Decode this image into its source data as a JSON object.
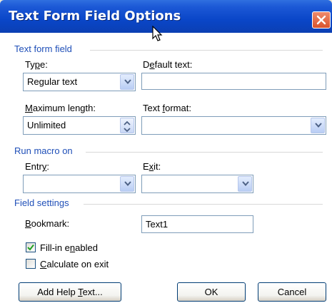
{
  "dialog": {
    "title": "Text Form Field Options"
  },
  "sections": {
    "text_form_field": "Text form field",
    "run_macro_on": "Run macro on",
    "field_settings": "Field settings"
  },
  "type_field": {
    "label_pre": "Ty",
    "label_key": "p",
    "label_post": "e:",
    "value": "Regular text"
  },
  "default_text": {
    "label_pre": "D",
    "label_key": "e",
    "label_post": "fault text:",
    "value": ""
  },
  "max_length": {
    "label_pre": "",
    "label_key": "M",
    "label_post": "aximum length:",
    "value": "Unlimited"
  },
  "text_format": {
    "label_pre": "Text ",
    "label_key": "f",
    "label_post": "ormat:",
    "value": ""
  },
  "entry": {
    "label_pre": "Entr",
    "label_key": "y",
    "label_post": ":",
    "value": ""
  },
  "exit": {
    "label_pre": "E",
    "label_key": "x",
    "label_post": "it:",
    "value": ""
  },
  "bookmark": {
    "label_pre": "",
    "label_key": "B",
    "label_post": "ookmark:",
    "value": "Text1"
  },
  "fill_in": {
    "label_pre": "Fill-in e",
    "label_key": "n",
    "label_post": "abled",
    "checked": true
  },
  "calc_exit": {
    "label_pre": "",
    "label_key": "C",
    "label_post": "alculate on exit",
    "checked": false
  },
  "buttons": {
    "help_pre": "Add Help ",
    "help_key": "T",
    "help_post": "ext...",
    "ok": "OK",
    "cancel": "Cancel"
  },
  "colors": {
    "title_blue": "#0a46c8",
    "section_blue": "#1f4fb8",
    "close_red": "#d9532c"
  },
  "icons": [
    "close-icon",
    "mouse-cursor-icon",
    "chevron-down-icon",
    "spinner-arrows-icon",
    "checkmark-icon"
  ]
}
